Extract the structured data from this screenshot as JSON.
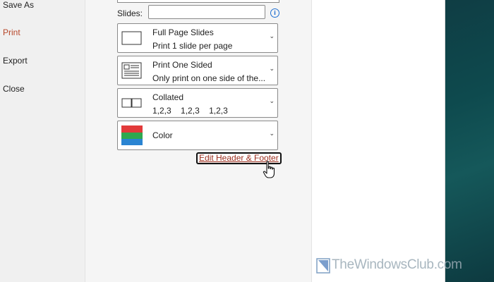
{
  "nav": {
    "items": [
      {
        "label": "Save As",
        "active": false
      },
      {
        "label": "Print",
        "active": true
      },
      {
        "label": "Export",
        "active": false
      },
      {
        "label": "Close",
        "active": false
      }
    ]
  },
  "settings": {
    "slides_label": "Slides:",
    "slides_value": "",
    "layout": {
      "line1": "Full Page Slides",
      "line2": "Print 1 slide per page"
    },
    "sides": {
      "line1": "Print One Sided",
      "line2": "Only print on one side of the..."
    },
    "collation": {
      "line1": "Collated",
      "values": [
        "1,2,3",
        "1,2,3",
        "1,2,3"
      ]
    },
    "color": {
      "label": "Color"
    },
    "edit_header_footer": "Edit Header & Footer"
  },
  "watermark": {
    "text": "TheWindowsClub.com"
  },
  "colors": {
    "accent": "#b7472a",
    "link": "#9c2c1c",
    "info": "#1f6fd1"
  }
}
